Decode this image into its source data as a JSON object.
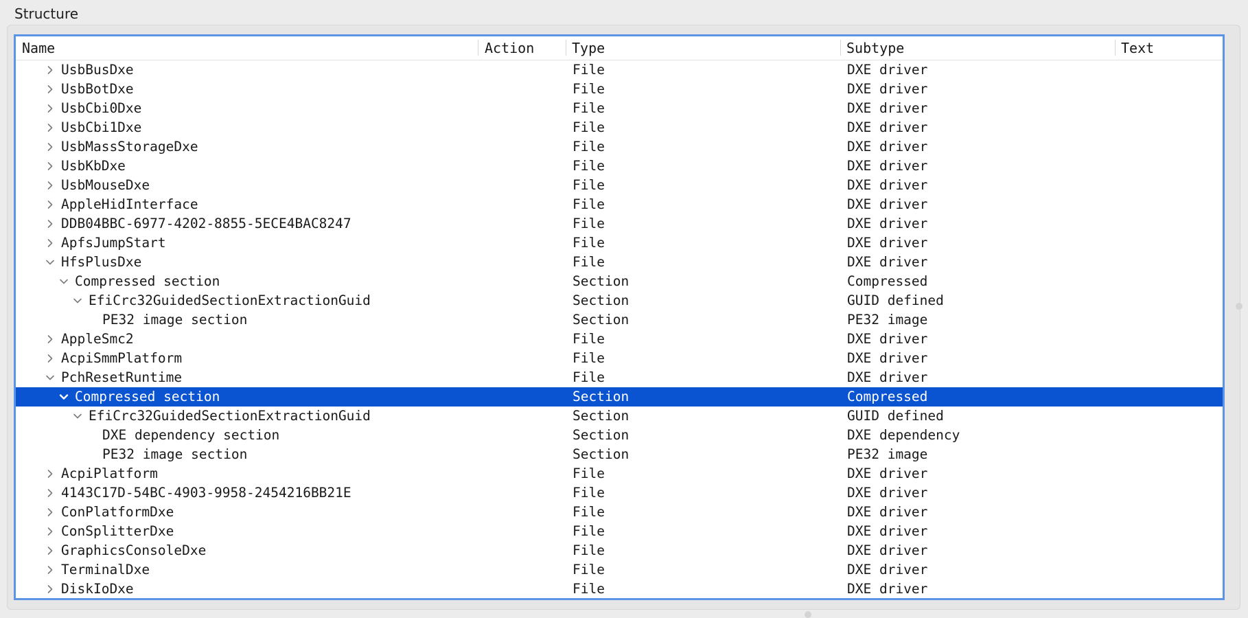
{
  "window": {
    "group_title": "Structure"
  },
  "columns": [
    "Name",
    "Action",
    "Type",
    "Subtype",
    "Text"
  ],
  "rows": [
    {
      "name": "UsbBusDxe",
      "type": "File",
      "subtype": "DXE driver",
      "depth": 0,
      "expander": "collapsed",
      "selected": false
    },
    {
      "name": "UsbBotDxe",
      "type": "File",
      "subtype": "DXE driver",
      "depth": 0,
      "expander": "collapsed",
      "selected": false
    },
    {
      "name": "UsbCbi0Dxe",
      "type": "File",
      "subtype": "DXE driver",
      "depth": 0,
      "expander": "collapsed",
      "selected": false
    },
    {
      "name": "UsbCbi1Dxe",
      "type": "File",
      "subtype": "DXE driver",
      "depth": 0,
      "expander": "collapsed",
      "selected": false
    },
    {
      "name": "UsbMassStorageDxe",
      "type": "File",
      "subtype": "DXE driver",
      "depth": 0,
      "expander": "collapsed",
      "selected": false
    },
    {
      "name": "UsbKbDxe",
      "type": "File",
      "subtype": "DXE driver",
      "depth": 0,
      "expander": "collapsed",
      "selected": false
    },
    {
      "name": "UsbMouseDxe",
      "type": "File",
      "subtype": "DXE driver",
      "depth": 0,
      "expander": "collapsed",
      "selected": false
    },
    {
      "name": "AppleHidInterface",
      "type": "File",
      "subtype": "DXE driver",
      "depth": 0,
      "expander": "collapsed",
      "selected": false
    },
    {
      "name": "DDB04BBC-6977-4202-8855-5ECE4BAC8247",
      "type": "File",
      "subtype": "DXE driver",
      "depth": 0,
      "expander": "collapsed",
      "selected": false
    },
    {
      "name": "ApfsJumpStart",
      "type": "File",
      "subtype": "DXE driver",
      "depth": 0,
      "expander": "collapsed",
      "selected": false
    },
    {
      "name": "HfsPlusDxe",
      "type": "File",
      "subtype": "DXE driver",
      "depth": 0,
      "expander": "expanded",
      "selected": false
    },
    {
      "name": "Compressed section",
      "type": "Section",
      "subtype": "Compressed",
      "depth": 1,
      "expander": "expanded",
      "selected": false
    },
    {
      "name": "EfiCrc32GuidedSectionExtractionGuid",
      "type": "Section",
      "subtype": "GUID defined",
      "depth": 2,
      "expander": "expanded",
      "selected": false
    },
    {
      "name": "PE32 image section",
      "type": "Section",
      "subtype": "PE32 image",
      "depth": 3,
      "expander": "none",
      "selected": false
    },
    {
      "name": "AppleSmc2",
      "type": "File",
      "subtype": "DXE driver",
      "depth": 0,
      "expander": "collapsed",
      "selected": false
    },
    {
      "name": "AcpiSmmPlatform",
      "type": "File",
      "subtype": "DXE driver",
      "depth": 0,
      "expander": "collapsed",
      "selected": false
    },
    {
      "name": "PchResetRuntime",
      "type": "File",
      "subtype": "DXE driver",
      "depth": 0,
      "expander": "expanded",
      "selected": false
    },
    {
      "name": "Compressed section",
      "type": "Section",
      "subtype": "Compressed",
      "depth": 1,
      "expander": "expanded",
      "selected": true
    },
    {
      "name": "EfiCrc32GuidedSectionExtractionGuid",
      "type": "Section",
      "subtype": "GUID defined",
      "depth": 2,
      "expander": "expanded",
      "selected": false
    },
    {
      "name": "DXE dependency section",
      "type": "Section",
      "subtype": "DXE dependency",
      "depth": 3,
      "expander": "none",
      "selected": false
    },
    {
      "name": "PE32 image section",
      "type": "Section",
      "subtype": "PE32 image",
      "depth": 3,
      "expander": "none",
      "selected": false
    },
    {
      "name": "AcpiPlatform",
      "type": "File",
      "subtype": "DXE driver",
      "depth": 0,
      "expander": "collapsed",
      "selected": false
    },
    {
      "name": "4143C17D-54BC-4903-9958-2454216BB21E",
      "type": "File",
      "subtype": "DXE driver",
      "depth": 0,
      "expander": "collapsed",
      "selected": false
    },
    {
      "name": "ConPlatformDxe",
      "type": "File",
      "subtype": "DXE driver",
      "depth": 0,
      "expander": "collapsed",
      "selected": false
    },
    {
      "name": "ConSplitterDxe",
      "type": "File",
      "subtype": "DXE driver",
      "depth": 0,
      "expander": "collapsed",
      "selected": false
    },
    {
      "name": "GraphicsConsoleDxe",
      "type": "File",
      "subtype": "DXE driver",
      "depth": 0,
      "expander": "collapsed",
      "selected": false
    },
    {
      "name": "TerminalDxe",
      "type": "File",
      "subtype": "DXE driver",
      "depth": 0,
      "expander": "collapsed",
      "selected": false
    },
    {
      "name": "DiskIoDxe",
      "type": "File",
      "subtype": "DXE driver",
      "depth": 0,
      "expander": "collapsed",
      "selected": false
    }
  ],
  "colors": {
    "selection": "#0a53d1",
    "focus_ring": "#5b93e5",
    "text": "#1a1a1a"
  }
}
